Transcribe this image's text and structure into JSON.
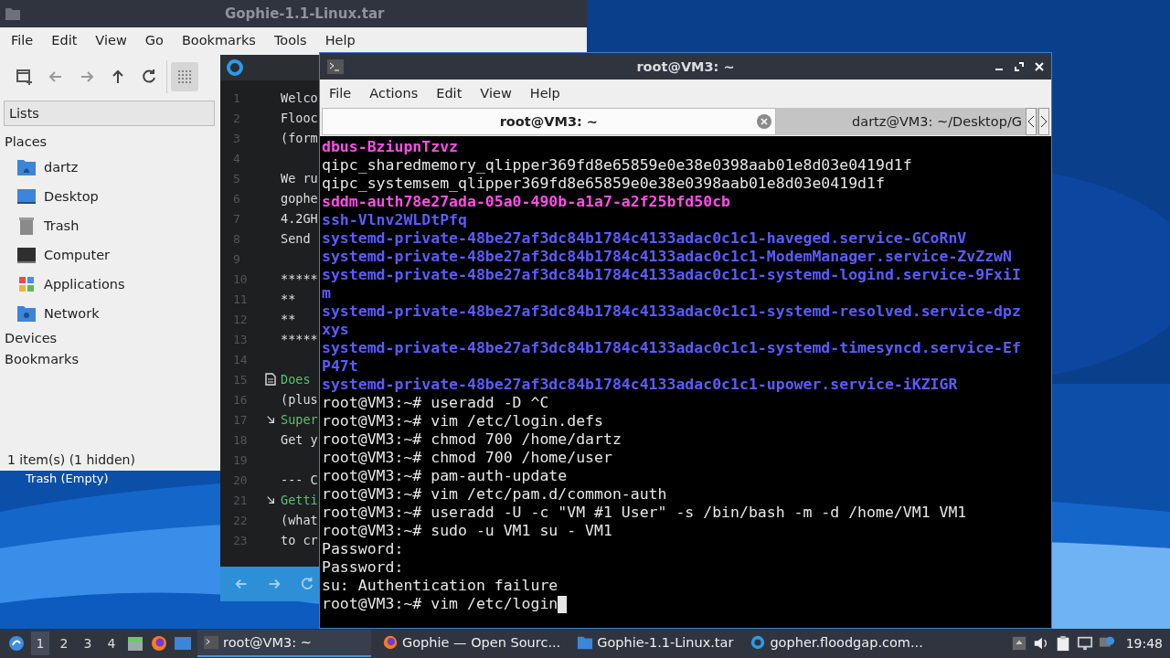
{
  "desktop": {
    "icon_label": "Trash (Empty)"
  },
  "file_manager": {
    "title": "Gophie-1.1-Linux.tar",
    "menu": [
      "File",
      "Edit",
      "View",
      "Go",
      "Bookmarks",
      "Tools",
      "Help"
    ],
    "toolbar": [
      {
        "kind": "new-tab",
        "selected": false
      },
      {
        "kind": "back",
        "selected": false
      },
      {
        "kind": "forward",
        "selected": false
      },
      {
        "kind": "up",
        "selected": false
      },
      {
        "kind": "reload",
        "selected": false
      },
      {
        "kind": "grid",
        "selected": true
      }
    ],
    "side_pane_mode": "Lists",
    "sections": [
      {
        "label": "Places",
        "items": [
          {
            "label": "dartz",
            "kind": "home"
          },
          {
            "label": "Desktop",
            "kind": "desktop"
          },
          {
            "label": "Trash",
            "kind": "trash"
          },
          {
            "label": "Computer",
            "kind": "computer"
          },
          {
            "label": "Applications",
            "kind": "apps"
          },
          {
            "label": "Network",
            "kind": "network"
          }
        ]
      },
      {
        "label": "Devices"
      },
      {
        "label": "Bookmarks"
      }
    ],
    "status": "1 item(s) (1 hidden)"
  },
  "gopher_window": {
    "lines": [
      {
        "number": "1",
        "text": "Welco",
        "kind": "text"
      },
      {
        "number": "2",
        "text": "Flooc",
        "kind": "text"
      },
      {
        "number": "3",
        "text": "(form",
        "kind": "text"
      },
      {
        "number": "4",
        "kind": "text"
      },
      {
        "number": "5",
        "text": "We ru",
        "kind": "text"
      },
      {
        "number": "6",
        "text": "gophe",
        "kind": "text"
      },
      {
        "number": "7",
        "text": "4.2GH",
        "kind": "text"
      },
      {
        "number": "8",
        "text": "Send",
        "kind": "text"
      },
      {
        "number": "9",
        "kind": "text"
      },
      {
        "number": "10",
        "text": "*****",
        "kind": "text"
      },
      {
        "number": "11",
        "text": "**",
        "kind": "text"
      },
      {
        "number": "12",
        "text": "**",
        "kind": "text"
      },
      {
        "number": "13",
        "text": "*****",
        "kind": "text"
      },
      {
        "number": "14",
        "kind": "text"
      },
      {
        "number": "15",
        "text": "Does",
        "kind": "document"
      },
      {
        "number": "16",
        "text": "(plus",
        "kind": "text"
      },
      {
        "number": "17",
        "text": "Super",
        "kind": "directory"
      },
      {
        "number": "18",
        "text": "Get y",
        "kind": "text"
      },
      {
        "number": "19",
        "kind": "text"
      },
      {
        "number": "20",
        "text": "--- C",
        "kind": "text"
      },
      {
        "number": "21",
        "text": "Getti",
        "kind": "directory"
      },
      {
        "number": "22",
        "text": "(what",
        "kind": "text"
      },
      {
        "number": "23",
        "text": "to cr",
        "kind": "text"
      }
    ]
  },
  "terminal": {
    "title": "root@VM3: ~",
    "menu": [
      "File",
      "Actions",
      "Edit",
      "View",
      "Help"
    ],
    "tabs": [
      {
        "label": "root@VM3: ~",
        "selected": true
      },
      {
        "label": "dartz@VM3: ~/Desktop/G",
        "selected": false
      }
    ],
    "lines": [
      {
        "text": "dbus-BziupnTzvz",
        "kind": "socket"
      },
      {
        "text": "qipc_sharedmemory_qlipper369fd8e65859e0e38e0398aab01e8d03e0419d1f",
        "kind": "file"
      },
      {
        "text": "qipc_systemsem_qlipper369fd8e65859e0e38e0398aab01e8d03e0419d1f",
        "kind": "file"
      },
      {
        "text": "sddm-auth78e27ada-05a0-490b-a1a7-a2f25bfd50cb",
        "kind": "socket"
      },
      {
        "text": "ssh-Vlnv2WLDtPfq",
        "kind": "directory"
      },
      {
        "text": "systemd-private-48be27af3dc84b1784c4133adac0c1c1-haveged.service-GCoRnV",
        "kind": "directory"
      },
      {
        "text": "systemd-private-48be27af3dc84b1784c4133adac0c1c1-ModemManager.service-ZvZzwN",
        "kind": "directory"
      },
      {
        "text": "systemd-private-48be27af3dc84b1784c4133adac0c1c1-systemd-logind.service-9FxiI",
        "kind": "directory"
      },
      {
        "text": "m",
        "kind": "directory"
      },
      {
        "text": "systemd-private-48be27af3dc84b1784c4133adac0c1c1-systemd-resolved.service-dpz",
        "kind": "directory"
      },
      {
        "text": "xys",
        "kind": "directory"
      },
      {
        "text": "systemd-private-48be27af3dc84b1784c4133adac0c1c1-systemd-timesyncd.service-Ef",
        "kind": "directory"
      },
      {
        "text": "P47t",
        "kind": "directory"
      },
      {
        "text": "systemd-private-48be27af3dc84b1784c4133adac0c1c1-upower.service-iKZIGR",
        "kind": "directory"
      },
      {
        "text": "root@VM3:~# useradd -D ^C",
        "kind": "output"
      },
      {
        "text": "root@VM3:~# vim /etc/login.defs",
        "kind": "output"
      },
      {
        "text": "root@VM3:~# chmod 700 /home/dartz",
        "kind": "output"
      },
      {
        "text": "root@VM3:~# chmod 700 /home/user",
        "kind": "output"
      },
      {
        "text": "root@VM3:~# pam-auth-update",
        "kind": "output"
      },
      {
        "text": "root@VM3:~# vim /etc/pam.d/common-auth",
        "kind": "output"
      },
      {
        "text": "root@VM3:~# useradd -U -c \"VM #1 User\" -s /bin/bash -m -d /home/VM1 VM1",
        "kind": "output"
      },
      {
        "text": "root@VM3:~# sudo -u VM1 su - VM1",
        "kind": "output"
      },
      {
        "text": "Password:",
        "kind": "output"
      },
      {
        "text": "Password:",
        "kind": "output"
      },
      {
        "text": "su: Authentication failure",
        "kind": "output"
      },
      {
        "text": "root@VM3:~# vim /etc/login",
        "kind": "output"
      }
    ]
  },
  "taskbar": {
    "workspaces": [
      {
        "label": "1",
        "selected": true
      },
      {
        "label": "2",
        "selected": false
      },
      {
        "label": "3",
        "selected": false
      },
      {
        "label": "4",
        "selected": false
      }
    ],
    "tasks": [
      {
        "label": "root@VM3: ~",
        "kind": "terminal",
        "selected": true
      },
      {
        "label": "Gophie — Open Sourc...",
        "kind": "browser",
        "selected": false
      },
      {
        "label": "Gophie-1.1-Linux.tar",
        "kind": "folder",
        "selected": false
      },
      {
        "label": "gopher.floodgap.com...",
        "kind": "gopher",
        "selected": false
      }
    ],
    "clock": "19:48"
  }
}
